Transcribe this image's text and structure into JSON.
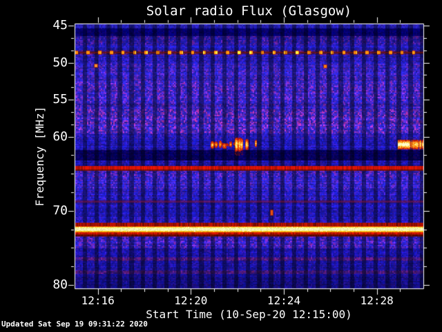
{
  "chart_data": {
    "type": "heatmap",
    "subtype": "radio-spectrogram",
    "title": "Solar radio Flux (Glasgow)",
    "xlabel": "Start Time (10-Sep-20 12:15:00)",
    "ylabel": "Frequency [MHz]",
    "updated_note": "Updated Sat Sep 19 09:31:22 2020",
    "x_axis": {
      "start_time": "12:15:00",
      "duration_minutes": 15,
      "minor_tick_every_minutes": 1,
      "ticks": [
        {
          "label": "12:16",
          "t": 0.0667
        },
        {
          "label": "12:20",
          "t": 0.3333
        },
        {
          "label": "12:24",
          "t": 0.6
        },
        {
          "label": "12:28",
          "t": 0.8667
        }
      ]
    },
    "y_axis": {
      "unit": "MHz",
      "f_top": 44.72,
      "f_bottom": 80.47,
      "major_ticks": [
        45,
        50,
        55,
        60,
        70,
        80
      ],
      "minor_ticks": [
        46.67,
        48.33,
        51.67,
        53.33,
        56.67,
        58.33,
        62.5,
        65,
        67.5,
        72.5,
        75,
        77.5
      ]
    },
    "palette": {
      "background": "#000000",
      "quiet_blue": "#2222c8",
      "dark_column_blue": "#000070",
      "rfi_red": "#c81400",
      "burst_orange": "#ff8c00",
      "burst_yellow": "#ffee66",
      "saturated_core": "#ffffc8",
      "axis": "#ffffff"
    },
    "banding": {
      "period_seconds": 30,
      "bright_fraction": 0.62,
      "dark_factor": 0.58
    },
    "freq_color_profile": [
      [
        44.72,
        45.4,
        "#1e1eb4",
        0.1
      ],
      [
        45.4,
        46.4,
        "#00006e",
        0.08
      ],
      [
        46.4,
        47.6,
        "#16169e",
        0.38
      ],
      [
        47.6,
        48.35,
        "#1b1bbe",
        0.15
      ],
      [
        48.35,
        48.95,
        "#2a1272",
        0.4
      ],
      [
        48.95,
        50.1,
        "#1a1ab6",
        0.22
      ],
      [
        50.1,
        52.6,
        "#2121c6",
        0.38
      ],
      [
        52.6,
        55.1,
        "#2323cc",
        0.55
      ],
      [
        55.1,
        56.3,
        "#2020c2",
        0.42
      ],
      [
        56.3,
        59.6,
        "#2525cc",
        0.72
      ],
      [
        59.6,
        60.35,
        "#1b1bbe",
        0.25
      ],
      [
        60.35,
        61.8,
        "#1818bc",
        0.15
      ],
      [
        61.8,
        63.2,
        "#000060",
        0.1
      ],
      [
        63.2,
        64.62,
        "#1414ac",
        0.15
      ],
      [
        64.62,
        65.4,
        "#1f1fc0",
        0.52
      ],
      [
        65.4,
        67.1,
        "#2121c6",
        0.36
      ],
      [
        67.1,
        68.6,
        "#1b1bc0",
        0.22
      ],
      [
        68.6,
        70.9,
        "#1717b4",
        0.14
      ],
      [
        70.9,
        71.6,
        "#1919bc",
        0.22
      ],
      [
        71.6,
        73.5,
        "#14129e",
        0.06
      ],
      [
        73.5,
        75.1,
        "#1f1fc2",
        0.48
      ],
      [
        75.1,
        76.25,
        "#1212a2",
        0.16
      ],
      [
        76.25,
        76.7,
        "#341684",
        0.35
      ],
      [
        76.7,
        78.05,
        "#12129e",
        0.14
      ],
      [
        78.05,
        78.55,
        "#2c1478",
        0.3
      ],
      [
        78.55,
        80.47,
        "#0e0e8c",
        0.12
      ]
    ],
    "rfi_lines": [
      {
        "type": "dashed",
        "f0": 48.4,
        "f1": 48.95,
        "dash_color": [
          255,
          144,
          16
        ],
        "bright_color": [
          255,
          200,
          56
        ],
        "between_color": [
          106,
          18,
          8
        ],
        "dash_fraction": 0.27
      },
      {
        "type": "solid",
        "f0": 63.95,
        "f1": 64.45,
        "f1_edge": 64.62,
        "color": [
          200,
          18,
          4
        ],
        "edge_color": [
          110,
          14,
          8
        ]
      },
      {
        "type": "faint",
        "f0": 68.6,
        "f1": 68.85,
        "color": [
          140,
          20,
          40
        ],
        "opacity": 0.5
      },
      {
        "type": "bright",
        "f0": 71.6,
        "f1": 73.5,
        "rows": [
          [
            71.6,
            72.1,
            [
              156,
              16,
              0
            ],
            0.35
          ],
          [
            72.1,
            72.2,
            [
              224,
              64,
              0
            ],
            0.2
          ],
          [
            72.78,
            72.9,
            [
              255,
              120,
              0
            ],
            0.2
          ],
          [
            72.9,
            73.2,
            [
              192,
              20,
              0
            ],
            0.3
          ],
          [
            73.2,
            73.5,
            [
              96,
              10,
              0
            ],
            0.3
          ]
        ],
        "core_f0": 72.2,
        "core_f1": 72.78,
        "core_colors": [
          [
            255,
            216,
            40
          ],
          [
            255,
            255,
            158
          ],
          [
            255,
            255,
            200
          ],
          [
            255,
            255,
            158
          ],
          [
            255,
            200,
            24
          ]
        ]
      }
    ],
    "bursts": {
      "line_mhz": 61.0,
      "baseline": {
        "t0": 0.388,
        "t1": 0.468,
        "f0": 60.85,
        "f1": 61.25,
        "color": [
          190,
          30,
          8
        ]
      },
      "spikes": [
        [
          0.394,
          5,
          60.55,
          61.5,
          0.82
        ],
        [
          0.4055,
          4,
          60.6,
          61.4,
          0.75
        ],
        [
          0.4175,
          4,
          60.5,
          61.45,
          0.8
        ],
        [
          0.4295,
          6,
          60.75,
          61.6,
          0.6
        ],
        [
          0.4485,
          4,
          60.55,
          61.3,
          0.72
        ],
        [
          0.4635,
          5,
          60.1,
          61.9,
          1.0
        ],
        [
          0.4725,
          4,
          60.15,
          61.85,
          0.97
        ],
        [
          0.479,
          4,
          60.2,
          61.8,
          0.95
        ],
        [
          0.4925,
          5,
          60.3,
          61.7,
          0.9
        ],
        [
          0.5185,
          3,
          60.4,
          61.35,
          0.88
        ]
      ],
      "band": {
        "t0": 0.927,
        "t1": 0.999,
        "f0": 60.4,
        "f1": 61.6,
        "core_t1": 0.958,
        "speckle_t0": 0.96
      }
    },
    "point_events": [
      {
        "t": 0.0614,
        "f": 50.45,
        "w": 4,
        "h": 4,
        "color": [
          255,
          148,
          40
        ]
      },
      {
        "t": 0.7188,
        "f": 50.5,
        "w": 4,
        "h": 4,
        "color": [
          255,
          128,
          20
        ]
      },
      {
        "t": 0.564,
        "f": 70.2,
        "w": 3,
        "h": 7,
        "color": [
          232,
          82,
          16
        ]
      }
    ]
  }
}
